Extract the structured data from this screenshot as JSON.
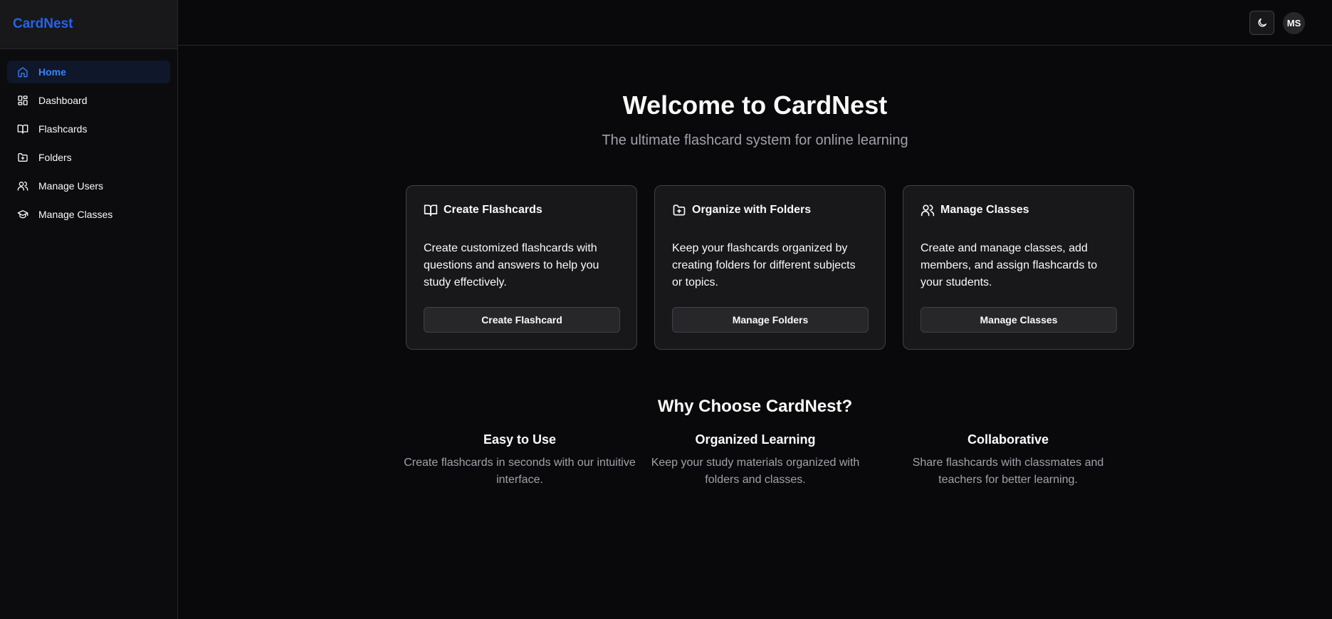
{
  "app": {
    "brand": "CardNest"
  },
  "sidebar": {
    "items": [
      {
        "label": "Home",
        "icon": "home-icon",
        "active": true
      },
      {
        "label": "Dashboard",
        "icon": "dashboard-icon",
        "active": false
      },
      {
        "label": "Flashcards",
        "icon": "book-icon",
        "active": false
      },
      {
        "label": "Folders",
        "icon": "folder-plus-icon",
        "active": false
      },
      {
        "label": "Manage Users",
        "icon": "users-icon",
        "active": false
      },
      {
        "label": "Manage Classes",
        "icon": "graduation-cap-icon",
        "active": false
      }
    ]
  },
  "topbar": {
    "theme_icon": "moon-icon",
    "avatar_initials": "MS"
  },
  "hero": {
    "title": "Welcome to CardNest",
    "subtitle": "The ultimate flashcard system for online learning"
  },
  "cards": [
    {
      "title": "Create Flashcards",
      "icon": "book-icon",
      "description": "Create customized flashcards with questions and answers to help you study effectively.",
      "button": "Create Flashcard"
    },
    {
      "title": "Organize with Folders",
      "icon": "folder-plus-icon",
      "description": "Keep your flashcards organized by creating folders for different subjects or topics.",
      "button": "Manage Folders"
    },
    {
      "title": "Manage Classes",
      "icon": "users-icon",
      "description": "Create and manage classes, add members, and assign flashcards to your students.",
      "button": "Manage Classes"
    }
  ],
  "why": {
    "title": "Why Choose CardNest?",
    "features": [
      {
        "title": "Easy to Use",
        "description": "Create flashcards in seconds with our intuitive interface."
      },
      {
        "title": "Organized Learning",
        "description": "Keep your study materials organized with folders and classes."
      },
      {
        "title": "Collaborative",
        "description": "Share flashcards with classmates and teachers for better learning."
      }
    ]
  },
  "colors": {
    "accent": "#2563eb",
    "background": "#09090b",
    "card": "#18181b",
    "muted_text": "#a1a1aa"
  }
}
